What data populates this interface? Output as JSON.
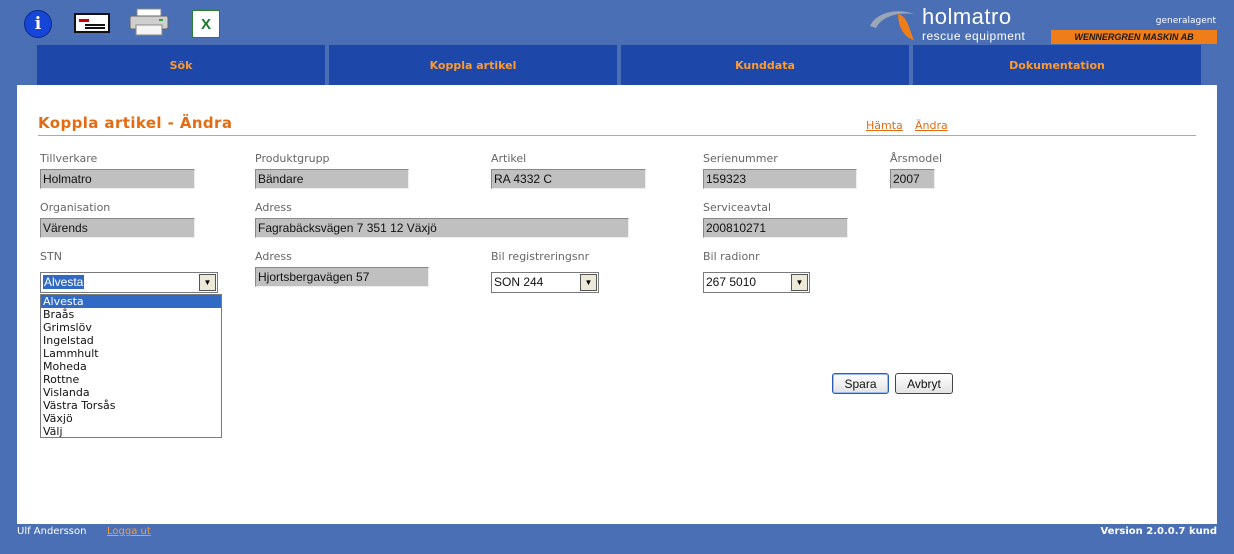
{
  "toolbar": {
    "info_glyph": "i",
    "excel_glyph": "X",
    "icons": [
      "info-icon",
      "contact-card-icon",
      "printer-icon",
      "excel-icon"
    ]
  },
  "brand": {
    "name": "holmatro",
    "tagline": "rescue equipment",
    "role": "generalagent",
    "dealer": "WENNERGREN MASKIN AB"
  },
  "nav": {
    "tabs": [
      "Sök",
      "Koppla artikel",
      "Kunddata",
      "Dokumentation"
    ]
  },
  "page": {
    "title": "Koppla artikel - Ändra",
    "links": {
      "fetch": "Hämta",
      "edit": "Ändra"
    }
  },
  "form": {
    "manufacturer": {
      "label": "Tillverkare",
      "value": "Holmatro"
    },
    "product_group": {
      "label": "Produktgrupp",
      "value": "Bändare"
    },
    "article": {
      "label": "Artikel",
      "value": "RA 4332 C"
    },
    "serial": {
      "label": "Serienummer",
      "value": "159323"
    },
    "model_year": {
      "label": "Årsmodel",
      "value": "2007"
    },
    "organisation": {
      "label": "Organisation",
      "value": "Värends"
    },
    "address1": {
      "label": "Adress",
      "value": "Fagrabäcksvägen 7  351 12 Växjö"
    },
    "service": {
      "label": "Serviceavtal",
      "value": "200810271"
    },
    "stn": {
      "label": "STN",
      "value": "Alvesta",
      "options": [
        "Alvesta",
        "Braås",
        "Grimslöv",
        "Ingelstad",
        "Lammhult",
        "Moheda",
        "Rottne",
        "Vislanda",
        "Västra Torsås",
        "Växjö",
        "Välj"
      ]
    },
    "address2": {
      "label": "Adress",
      "value": "Hjortsbergavägen 57"
    },
    "car_reg": {
      "label": "Bil registreringsnr",
      "value": "SON 244"
    },
    "car_radio": {
      "label": "Bil radionr",
      "value": "267 5010"
    }
  },
  "buttons": {
    "save": "Spara",
    "cancel": "Avbryt"
  },
  "footer": {
    "user": "Ulf Andersson",
    "logout": "Logga ut",
    "version": "Version 2.0.0.7 kund"
  },
  "colors": {
    "background": "#4a6fb5",
    "nav_tab": "#1d47a8",
    "accent_orange": "#e36c12",
    "field_gray": "#c0c0c0",
    "selection_blue": "#316ac5"
  }
}
